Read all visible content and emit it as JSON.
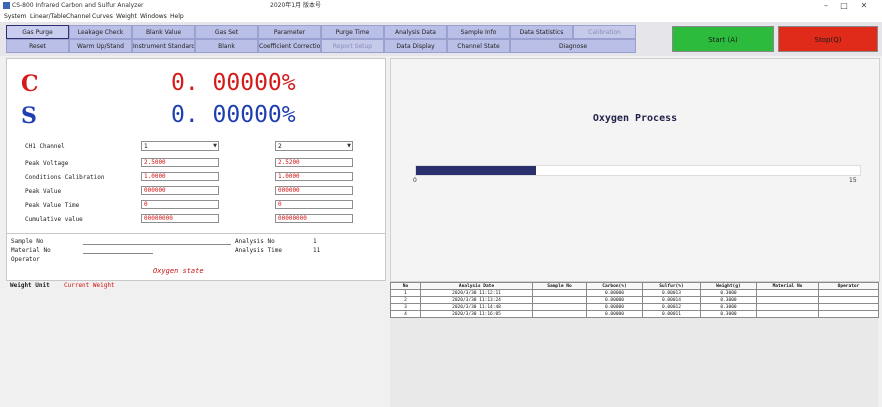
{
  "window": {
    "title": "CS-800 Infrared Carbon and Sulfur Analyzer",
    "sub_title": "2020年1月  版本号",
    "minimize": "–",
    "maximize": "□",
    "close": "✕"
  },
  "menu": [
    "System",
    "Linear/Table",
    "Channel",
    "Curves",
    "Weight",
    "Windows",
    "Help"
  ],
  "toolbar": {
    "row1": [
      "Gas Purge",
      "Leakage Check",
      "Blank Value",
      "Gas Set",
      "Parameter",
      "Purge Time",
      "Analysis Data",
      "Sample Info",
      "Data Statistics",
      "Calibration"
    ],
    "row2": [
      "Reset",
      "Warm Up/Stand",
      "Instrument Standard",
      "Blank",
      "Coefficient Correction",
      "Report Setup",
      "Data Display",
      "Channel State",
      "Diagnose"
    ],
    "start_label": "Start (A)",
    "stop_label": "Stop(Q)",
    "start_color": "#2dbb3d",
    "stop_color": "#e02a1a"
  },
  "results": {
    "c_label": "C",
    "c_value": "0. 00000%",
    "c_color": "#d41a1a",
    "s_label": "S",
    "s_value": "0. 00000%",
    "s_color": "#1f3fb0"
  },
  "params": {
    "labels": [
      "CH1 Channel",
      "Peak Voltage",
      "Conditions Calibration",
      "Peak Value",
      "Peak Value Time",
      "Cumulative value"
    ],
    "c_values": [
      "1",
      "2.5000",
      "1.0000",
      "000000",
      "0",
      "00000000"
    ],
    "s_values": [
      "2",
      "2.5200",
      "1.0000",
      "000000",
      "0",
      "00000000"
    ]
  },
  "sample": {
    "sample_no_label": "Sample No",
    "material_label": "Material No",
    "operator_label": "Operator",
    "analysis_no_label": "Analysis No",
    "analysis_no_value": "1",
    "analysis_time_label": "Analysis Time",
    "analysis_time_value": "11",
    "state": "Oxygen state"
  },
  "weight": {
    "label": "Weight Unit",
    "value": "Current Weight"
  },
  "process": {
    "title": "Oxygen Process",
    "progress_start": "0",
    "progress_end": "15",
    "progress_fraction": 0.27
  },
  "table": {
    "headers": [
      "No",
      "Analysis Date",
      "Sample No",
      "Carbon(%)",
      "Sulfur(%)",
      "Weight(g)",
      "Material No",
      "Operator"
    ],
    "rows": [
      [
        "1",
        "2020/3/30 11:12:11",
        "",
        "0.00000",
        "0.00013",
        "0.3000",
        "",
        ""
      ],
      [
        "2",
        "2020/3/30 11:13:24",
        "",
        "0.00000",
        "0.00014",
        "0.3000",
        "",
        ""
      ],
      [
        "3",
        "2020/3/30 11:14:48",
        "",
        "0.00000",
        "0.00012",
        "0.3000",
        "",
        ""
      ],
      [
        "4",
        "2020/3/30 11:16:05",
        "",
        "0.00000",
        "0.00011",
        "0.3000",
        "",
        ""
      ]
    ]
  }
}
